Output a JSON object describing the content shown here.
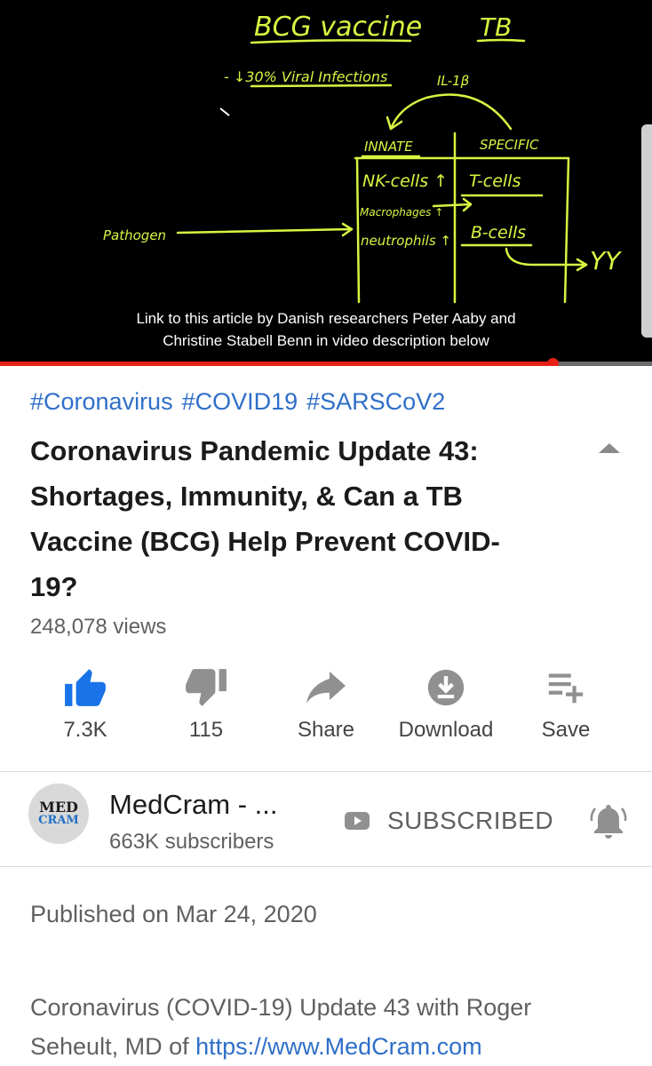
{
  "video": {
    "caption_line1": "Link to this article by Danish researchers Peter Aaby and",
    "caption_line2": "Christine Stabell Benn in video description below",
    "progress": 0.848,
    "whiteboard": {
      "bcg": "BCG vaccine",
      "tb": "TB",
      "viral": "- ↓30% Viral Infections",
      "il": "IL-1β",
      "innate": "INNATE",
      "specific": "SPECIFIC",
      "nk": "NK-cells ↑",
      "tcells": "T-cells",
      "macrophages": "Macrophages ↑",
      "neutrophils": "neutrophils ↑",
      "bcells": "B-cells",
      "pathogen": "Pathogen",
      "antibodies": "YY"
    }
  },
  "info": {
    "hashtags": [
      "#Coronavirus",
      "#COVID19",
      "#SARSCoV2"
    ],
    "title": "Coronavirus Pandemic Update 43: Shortages, Immunity, & Can a TB Vaccine (BCG) Help Prevent COVID-19?",
    "views": "248,078 views"
  },
  "actions": {
    "like": "7.3K",
    "dislike": "115",
    "share": "Share",
    "download": "Download",
    "save": "Save"
  },
  "channel": {
    "avatar_line1": "MED",
    "avatar_line2": "CRAM",
    "name": "MedCram - ...",
    "subscribers": "663K subscribers",
    "subscribe_label": "SUBSCRIBED"
  },
  "description": {
    "published": "Published on Mar 24, 2020",
    "text": "Coronavirus (COVID-19) Update 43 with Roger Seheult, MD of ",
    "link": "https://www.MedCram.com"
  },
  "colors": {
    "accent_blue": "#2f6fc8",
    "like_active": "#1a73e8",
    "progress_red": "#e62117",
    "chalk": "#d8f542"
  }
}
